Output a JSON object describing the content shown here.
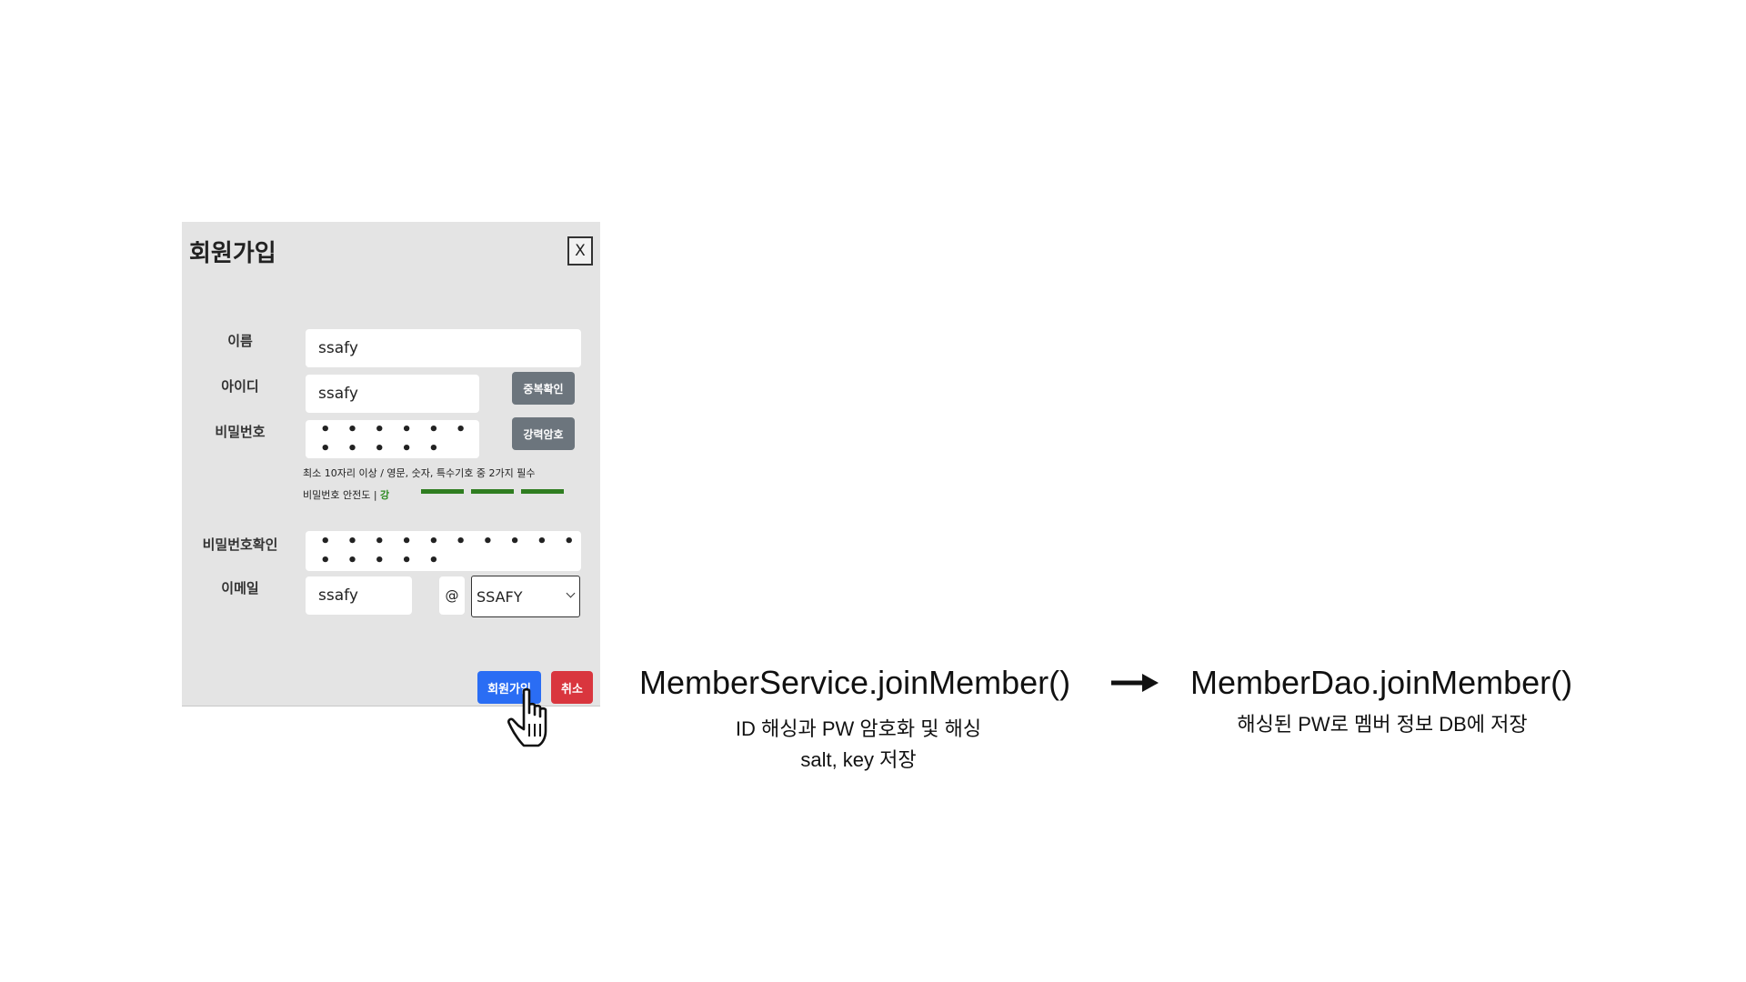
{
  "modal": {
    "title": "회원가입",
    "close_label": "X",
    "name_label": "이름",
    "name_value": "ssafy",
    "id_label": "아이디",
    "id_value": "ssafy",
    "id_check_button": "중복확인",
    "password_label": "비밀번호",
    "password_value": "• • • • • • • • • • •",
    "strong_password_button": "강력암호",
    "password_hint": "최소 10자리 이상 / 영문, 숫자, 특수기호 중 2가지 필수",
    "strength_prefix": "비밀번호 안전도 | ",
    "strength_value": "강",
    "strength_level": "3/3",
    "strength_color": "#2f7d20",
    "password_confirm_label": "비밀번호확인",
    "password_confirm_value": "• • • • • • • • • • • • • • •",
    "email_label": "이메일",
    "email_value": "ssafy",
    "email_at": "@",
    "email_domain": "SSAFY",
    "submit_button": "회원가입",
    "cancel_button": "취소",
    "cursor_icon": "hand-pointer-icon"
  },
  "flow": {
    "step1_method": "MemberService.joinMember()",
    "step1_desc_line1": "ID 해싱과 PW 암호화 및 해싱",
    "step1_desc_line2": "salt, key 저장",
    "arrow_icon": "right-arrow-icon",
    "step2_method": "MemberDao.joinMember()",
    "step2_desc": "해싱된 PW로 멤버 정보 DB에 저장"
  }
}
